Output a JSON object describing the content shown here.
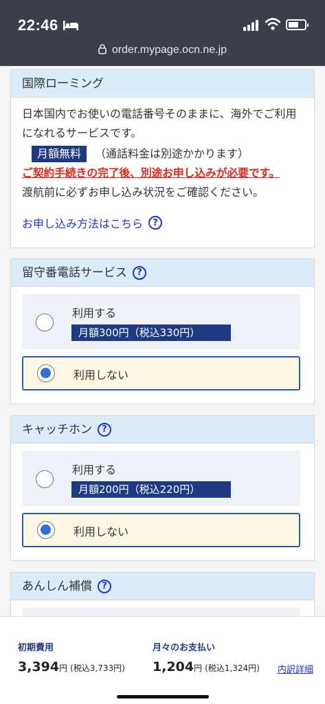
{
  "status_bar": {
    "time": "22:46",
    "icons": [
      "bed-icon",
      "signal-icon",
      "wifi-icon",
      "battery-icon"
    ]
  },
  "browser": {
    "url": "order.mypage.ocn.ne.jp"
  },
  "roaming": {
    "title": "国際ローミング",
    "desc_1": "日本国内でお使いの電話番号そのままに、海外でご利用になれるサービスです。",
    "free_badge": "月額無料",
    "free_note": "（通話料金は別途かかります）",
    "warning": "ご契約手続きの完了後、別途お申し込みが必要です。",
    "desc_2": "渡航前に必ずお申し込み状況をご確認ください。",
    "link": "お申し込み方法はこちら"
  },
  "voicemail": {
    "title": "留守番電話サービス",
    "use_label": "利用する",
    "use_price": "月額300円（税込330円）",
    "none_label": "利用しない",
    "selected": "利用しない"
  },
  "catch_phone": {
    "title": "キャッチホン",
    "use_label": "利用する",
    "use_price": "月額200円（税込220円）",
    "none_label": "利用しない",
    "selected": "利用しない"
  },
  "anshin": {
    "title": "あんしん補償"
  },
  "footer": {
    "initial_label": "初期費用",
    "initial_amount": "3,394",
    "initial_unit": "円",
    "initial_tax": "(税込3,733円)",
    "monthly_label": "月々のお支払い",
    "monthly_amount": "1,204",
    "monthly_unit": "円",
    "monthly_tax": "(税込1,324円)",
    "detail_link": "内訳詳細"
  },
  "colors": {
    "header_bg": "#3a3f4a",
    "card_head_bg": "#dcedf9",
    "badge_navy": "#1e3a82",
    "warning_red": "#e0281a",
    "link_blue": "#1f35c9",
    "selected_bg": "#fcf8e3"
  }
}
